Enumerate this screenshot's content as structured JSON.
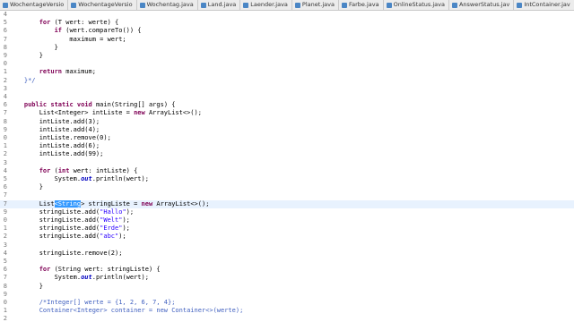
{
  "tabs": [
    {
      "label": "WochentageVersio",
      "active": false
    },
    {
      "label": "WochentageVersio",
      "active": false
    },
    {
      "label": "Wochentag.java",
      "active": false
    },
    {
      "label": "Land.java",
      "active": false
    },
    {
      "label": "Laender.java",
      "active": false
    },
    {
      "label": "Planet.java",
      "active": false
    },
    {
      "label": "Farbe.java",
      "active": false
    },
    {
      "label": "OnlineStatus.java",
      "active": false
    },
    {
      "label": "AnswerStatus.jav",
      "active": false
    },
    {
      "label": "IntContainer.jav",
      "active": false
    },
    {
      "label": "Container.jav",
      "active": true
    }
  ],
  "code": {
    "lines": [
      {
        "num": "4",
        "text": ""
      },
      {
        "num": "5",
        "text": "        for (T wert: werte) {"
      },
      {
        "num": "6",
        "text": "            if (wert.compareTo()) {"
      },
      {
        "num": "7",
        "text": "                maximum = wert;"
      },
      {
        "num": "8",
        "text": "            }"
      },
      {
        "num": "9",
        "text": "        }"
      },
      {
        "num": "0",
        "text": ""
      },
      {
        "num": "1",
        "text": "        return maximum;"
      },
      {
        "num": "2",
        "text": "    }*/"
      },
      {
        "num": "3",
        "text": ""
      },
      {
        "num": "4",
        "text": ""
      },
      {
        "num": "6",
        "text": "    public static void main(String[] args) {"
      },
      {
        "num": "7",
        "text": "        List<Integer> intListe = new ArrayList<>();"
      },
      {
        "num": "8",
        "text": "        intListe.add(3);"
      },
      {
        "num": "9",
        "text": "        intListe.add(4);"
      },
      {
        "num": "0",
        "text": "        intListe.remove(0);"
      },
      {
        "num": "1",
        "text": "        intListe.add(6);"
      },
      {
        "num": "2",
        "text": "        intListe.add(99);"
      },
      {
        "num": "3",
        "text": ""
      },
      {
        "num": "4",
        "text": "        for (int wert: intListe) {"
      },
      {
        "num": "5",
        "text": "            System.out.println(wert);"
      },
      {
        "num": "6",
        "text": "        }"
      },
      {
        "num": "7",
        "text": ""
      },
      {
        "num": "7",
        "text": "        List<String> stringListe = new ArrayList<>();"
      },
      {
        "num": "9",
        "text": "        stringListe.add(\"Hallo\");"
      },
      {
        "num": "0",
        "text": "        stringListe.add(\"Welt\");"
      },
      {
        "num": "1",
        "text": "        stringListe.add(\"Erde\");"
      },
      {
        "num": "2",
        "text": "        stringListe.add(\"abc\");"
      },
      {
        "num": "3",
        "text": ""
      },
      {
        "num": "4",
        "text": "        stringListe.remove(2);"
      },
      {
        "num": "5",
        "text": ""
      },
      {
        "num": "6",
        "text": "        for (String wert: stringListe) {"
      },
      {
        "num": "7",
        "text": "            System.out.println(wert);"
      },
      {
        "num": "8",
        "text": "        }"
      },
      {
        "num": "9",
        "text": ""
      },
      {
        "num": "0",
        "text": "        /*Integer[] werte = {1, 2, 6, 7, 4};"
      },
      {
        "num": "1",
        "text": "        Container<Integer> container = new Container<>(werte);"
      },
      {
        "num": "2",
        "text": ""
      }
    ],
    "current_line_index": 23
  },
  "colors": {
    "keyword": "#7f0055",
    "string": "#2a00ff",
    "comment": "#3f5fbf",
    "static_method": "#0000c0",
    "selection": "#3399ff",
    "current_line": "#e8f2fe"
  }
}
